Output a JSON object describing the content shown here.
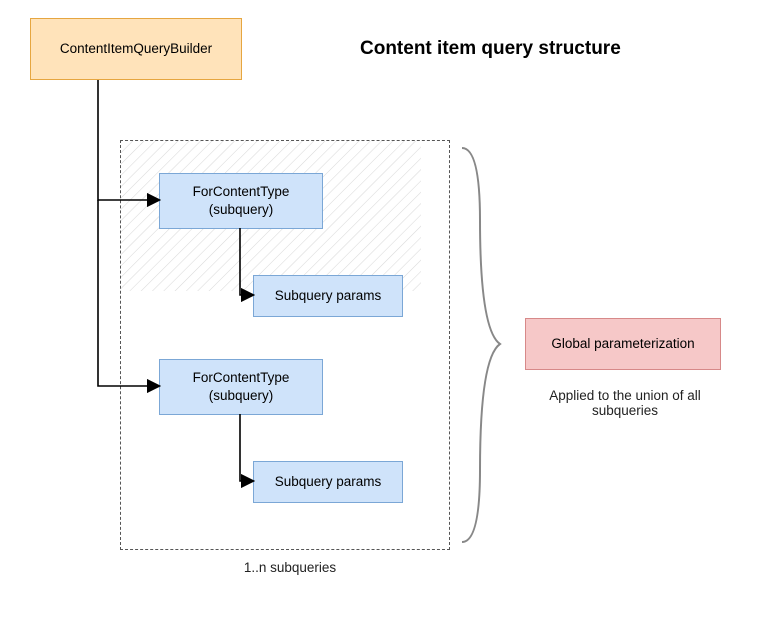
{
  "title": "Content item query structure",
  "builder": {
    "label": "ContentItemQueryBuilder"
  },
  "subquery1": {
    "label": "ForContentType\n(subquery)",
    "params_label": "Subquery params"
  },
  "subquery2": {
    "label": "ForContentType\n(subquery)",
    "params_label": "Subquery params"
  },
  "container_caption": "1..n subqueries",
  "global": {
    "label": "Global parameterization",
    "caption": "Applied to the union of all subqueries"
  },
  "colors": {
    "builder_fill": "#ffe3ba",
    "builder_border": "#e6a640",
    "subquery_fill": "#cfe3fa",
    "subquery_border": "#7ba7d6",
    "global_fill": "#f6c8c8",
    "global_border": "#d78989"
  }
}
